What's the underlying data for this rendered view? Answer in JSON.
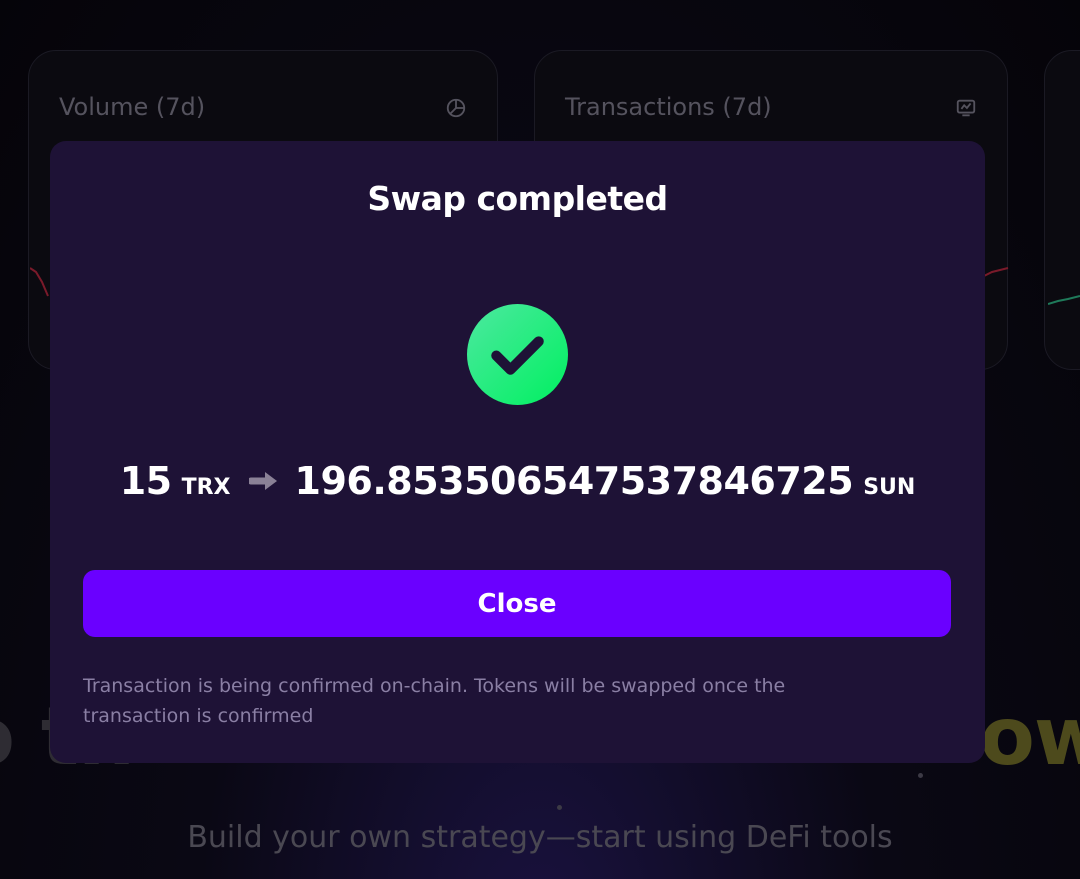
{
  "background": {
    "cards": [
      {
        "title": "Volume (7d)",
        "icon": "pie-chart-icon"
      },
      {
        "title": "Transactions (7d)",
        "icon": "monitor-chart-icon"
      }
    ],
    "hero_left": "o th",
    "hero_right": "owe",
    "subtitle": "Build your own strategy—start using DeFi tools"
  },
  "modal": {
    "title": "Swap completed",
    "status_icon": "check-circle-icon",
    "swap": {
      "from_amount": "15",
      "from_unit": "TRX",
      "arrow_icon": "arrow-right-icon",
      "to_amount": "196.853506547537846725",
      "to_unit": "SUN"
    },
    "close_label": "Close",
    "note": "Transaction is being confirmed on-chain. Tokens will be swapped once the transaction is confirmed"
  },
  "colors": {
    "modal_bg": "#1e1236",
    "accent": "#6a00ff",
    "success": "#22e07a"
  }
}
